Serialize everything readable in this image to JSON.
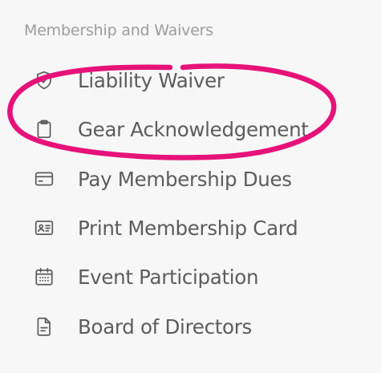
{
  "section": {
    "title": "Membership and Waivers"
  },
  "menu": {
    "items": [
      {
        "label": "Liability Waiver",
        "icon": "shield-check-icon"
      },
      {
        "label": "Gear Acknowledgement",
        "icon": "clipboard-icon"
      },
      {
        "label": "Pay Membership Dues",
        "icon": "credit-card-icon"
      },
      {
        "label": "Print Membership Card",
        "icon": "id-card-icon"
      },
      {
        "label": "Event Participation",
        "icon": "calendar-icon"
      },
      {
        "label": "Board of Directors",
        "icon": "document-icon"
      }
    ]
  },
  "colors": {
    "background": "#f7f7f7",
    "section_title": "#9c9c9c",
    "item_text": "#5c5c5c",
    "icon_stroke": "#5c5c5c",
    "highlight": "#e6127a"
  }
}
